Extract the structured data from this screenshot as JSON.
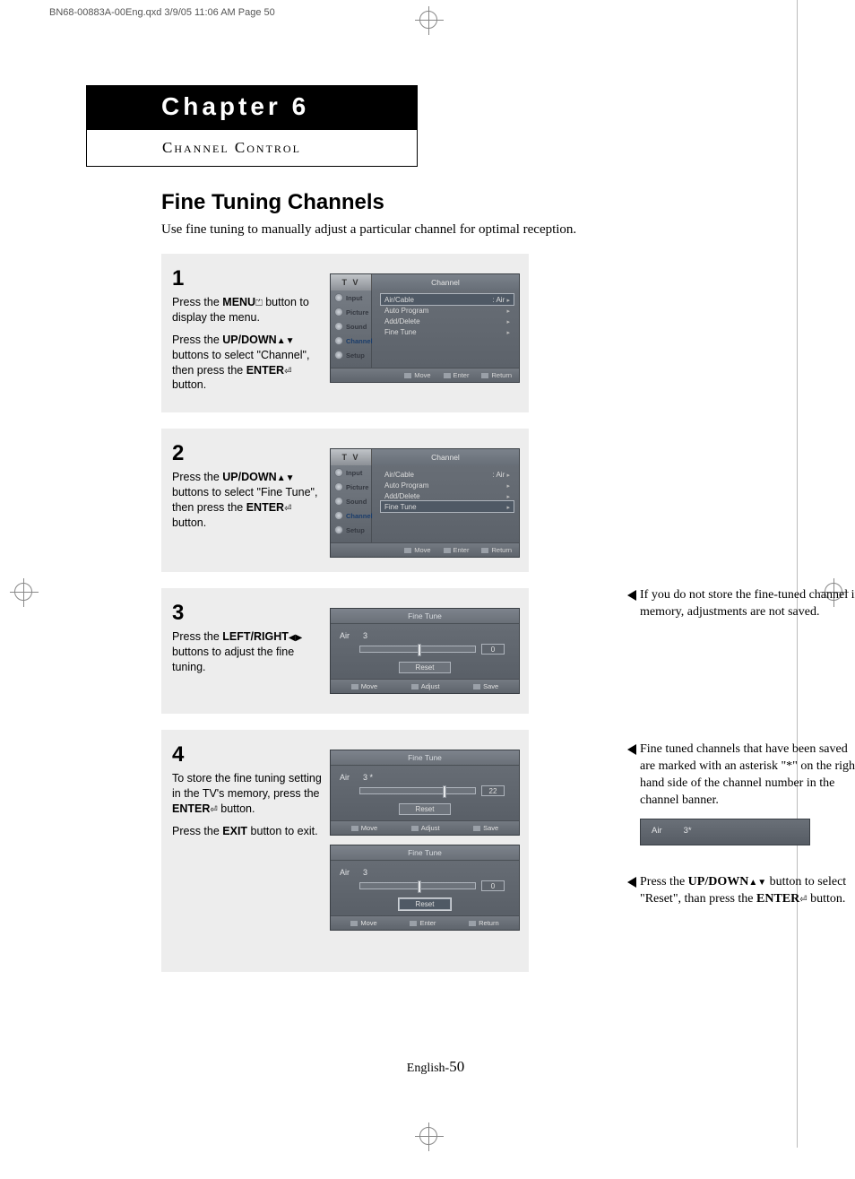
{
  "print_header": "BN68-00883A-00Eng.qxd  3/9/05 11:06 AM  Page 50",
  "chapter": "Chapter 6",
  "chapter_sub": "Channel Control",
  "section_title": "Fine Tuning Channels",
  "intro": "Use fine tuning to manually adjust a particular channel for optimal reception.",
  "steps": [
    {
      "num": "1",
      "paras": [
        "Press the <b>MENU</b><span class='glyph'>⏍</span> button to display the menu.",
        "Press the <b>UP/DOWN</b><span class='glyph'>▲▼</span> buttons to select \"Channel\", then press the <b>ENTER</b><span class='glyph'>⏎</span> button."
      ]
    },
    {
      "num": "2",
      "paras": [
        "Press the <b>UP/DOWN</b><span class='glyph'>▲▼</span> buttons to select \"Fine Tune\", then press the <b>ENTER</b><span class='glyph'>⏎</span> button."
      ]
    },
    {
      "num": "3",
      "paras": [
        "Press the <b>LEFT/RIGHT</b><span class='glyph'>◀▶</span> buttons to adjust the fine tuning."
      ]
    },
    {
      "num": "4",
      "paras": [
        "To store the fine tuning setting in the TV's memory, press the <b>ENTER</b><span class='glyph'>⏎</span> button.",
        "Press the <b>EXIT</b> button to exit."
      ]
    }
  ],
  "osd_common": {
    "tv": "T V",
    "side": [
      "Input",
      "Picture",
      "Sound",
      "Channel",
      "Setup"
    ]
  },
  "osd1": {
    "title": "Channel",
    "rows": [
      {
        "l": "Air/Cable",
        "r": ": Air",
        "hl": true
      },
      {
        "l": "Auto Program",
        "r": ""
      },
      {
        "l": "Add/Delete",
        "r": ""
      },
      {
        "l": "Fine Tune",
        "r": ""
      }
    ],
    "foot": [
      "Move",
      "Enter",
      "Return"
    ]
  },
  "osd2": {
    "title": "Channel",
    "rows": [
      {
        "l": "Air/Cable",
        "r": ": Air"
      },
      {
        "l": "Auto Program",
        "r": ""
      },
      {
        "l": "Add/Delete",
        "r": ""
      },
      {
        "l": "Fine Tune",
        "r": "",
        "hl": true
      }
    ],
    "foot": [
      "Move",
      "Enter",
      "Return"
    ]
  },
  "ft3": {
    "title": "Fine Tune",
    "ch": "Air      3",
    "val": "0",
    "handle": 50,
    "reset": "Reset",
    "reset_hl": false,
    "foot": [
      "Move",
      "Adjust",
      "Save"
    ]
  },
  "ft4a": {
    "title": "Fine Tune",
    "ch": "Air      3 *",
    "val": "22",
    "handle": 72,
    "reset": "Reset",
    "reset_hl": false,
    "foot": [
      "Move",
      "Adjust",
      "Save"
    ]
  },
  "ft4b": {
    "title": "Fine Tune",
    "ch": "Air      3",
    "val": "0",
    "handle": 50,
    "reset": "Reset",
    "reset_hl": true,
    "foot": [
      "Move",
      "Enter",
      "Return"
    ]
  },
  "notes": {
    "n1": "If you do not store the fine-tuned channel in memory, adjustments are not saved.",
    "n2": "Fine tuned channels that have been saved are marked with an asterisk \"*\" on the right-hand side of the channel number in the channel banner.",
    "n3": "Press the <b>UP/DOWN</b><span class='glyph'>▲▼</span> button to select \"Reset\", than press the <b>ENTER</b><span class='glyph'>⏎</span> button.",
    "banner_l": "Air",
    "banner_r": "3*"
  },
  "footer_lang": "English-",
  "footer_page": "50"
}
